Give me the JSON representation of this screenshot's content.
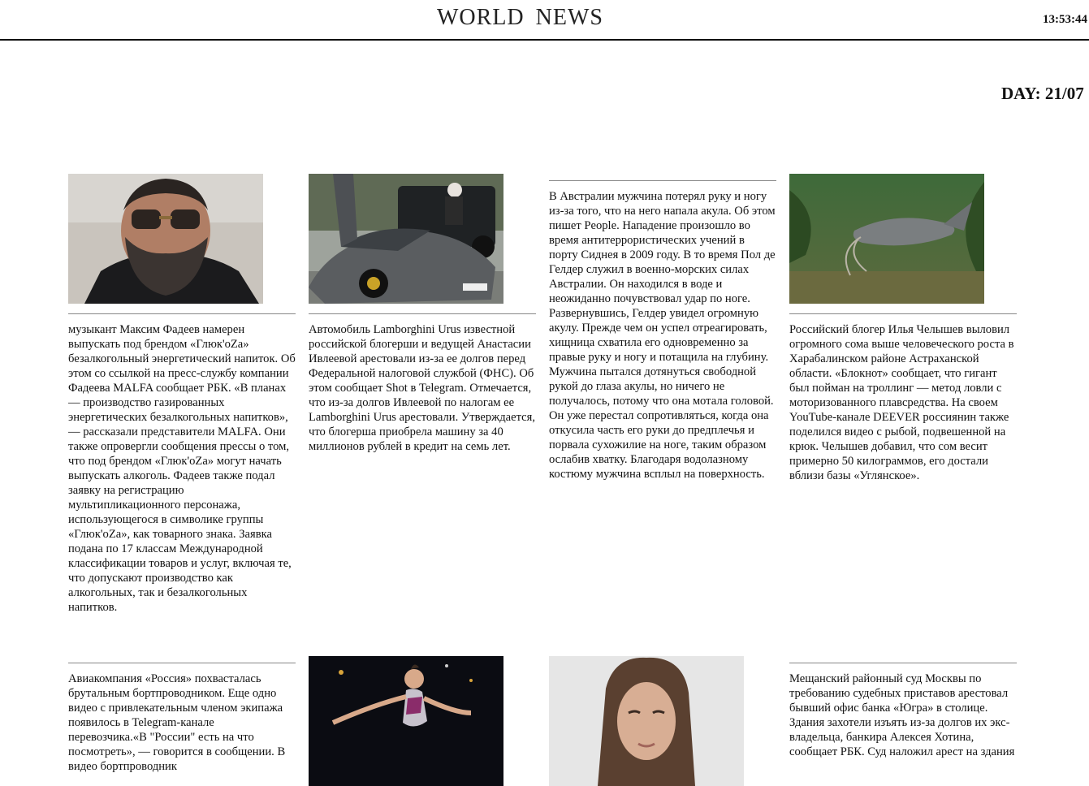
{
  "header": {
    "title": "WORLD  NEWS",
    "clock": "13:53:44",
    "day": "DAY: 21/07"
  },
  "articles": [
    {
      "image": "man-sunglasses-beard-photo",
      "text": "музыкант Максим Фадеев намерен выпускать под брендом «Глюк'oZa» безалкогольный энергетический напиток. Об этом со ссылкой на пресс-службу компании Фадеева MALFA сообщает РБК. «В планах — производство газированных энергетических безалкогольных напитков», — рассказали представители MALFA. Они также опровергли сообщения прессы о том, что под брендом «Глюк'oZa» могут начать выпускать алкоголь. Фадеев также подал заявку на регистрацию мультипликационного персонажа, использующегося в символике группы «Глюк'oZa», как товарного знака. Заявка подана по 17 классам Международной классификации товаров и услуг, включая те, что допускают производство как алкогольных, так и безалкогольных напитков."
    },
    {
      "image": "lamborghini-car-photo",
      "text": "Автомобиль Lamborghini Urus известной российской блогерши и ведущей Анастасии Ивлеевой арестовали из-за ее долгов перед Федеральной налоговой службой (ФНС). Об этом сообщает Shot в Telegram. Отмечается, что из-за долгов Ивлеевой по налогам ее Lamborghini Urus арестовали. Утверждается, что блогерша приобрела машину за 40 миллионов рублей в кредит на семь лет."
    },
    {
      "image": "",
      "text": "В Австралии мужчина потерял руку и ногу из-за того, что на него напала акула. Об этом пишет People. Нападение произошло во время антитеррористических учений в порту Сиднея в 2009 году. В то время Пол де Гелдер служил в военно-морских силах Австралии. Он находился в воде и неожиданно почувствовал удар по ноге. Развернувшись, Гелдер увидел огромную акулу. Прежде чем он успел отреагировать, хищница схватила его одновременно за правые руку и ногу и потащила на глубину. Мужчина пытался дотянуться свободной рукой до глаза акулы, но ничего не получалось, потому что она мотала головой. Он уже перестал сопротивляться, когда она откусила часть его руки до предплечья и порвала сухожилие на ноге, таким образом ослабив хватку. Благодаря водолазному костюму мужчина всплыл на поверхность."
    },
    {
      "image": "catfish-underwater-photo",
      "text": "Российский блогер Илья Челышев выловил огромного сома выше человеческого роста в Харабалинском районе Астраханской области. «Блокнот» сообщает, что гигант был пойман на троллинг — метод ловли с моторизованного плавсредства. На своем YouTube-канале DEEVER россиянин также поделился видео с рыбой, подвешенной на крюк. Челышев добавил, что сом весит примерно 50 килограммов, его достали вблизи базы «Углянское»."
    },
    {
      "image": "",
      "text": "Авиакомпания «Россия» похвасталась брутальным бортпроводником. Еще одно видео с привлекательным членом экипажа появилось в Telegram-канале перевозчика.«В \"России\" есть на что посмотреть», — говорится в сообщении. В видео бортпроводник"
    },
    {
      "image": "gymnast-photo",
      "text": ""
    },
    {
      "image": "woman-portrait-photo",
      "text": ""
    },
    {
      "image": "",
      "text": "Мещанский районный суд Москвы по требованию судебных приставов арестовал бывший офис банка «Югра» в столице. Здания захотели изъять из-за долгов их экс-владельца, банкира Алексея Хотина, сообщает РБК. Суд наложил арест на здания"
    }
  ]
}
